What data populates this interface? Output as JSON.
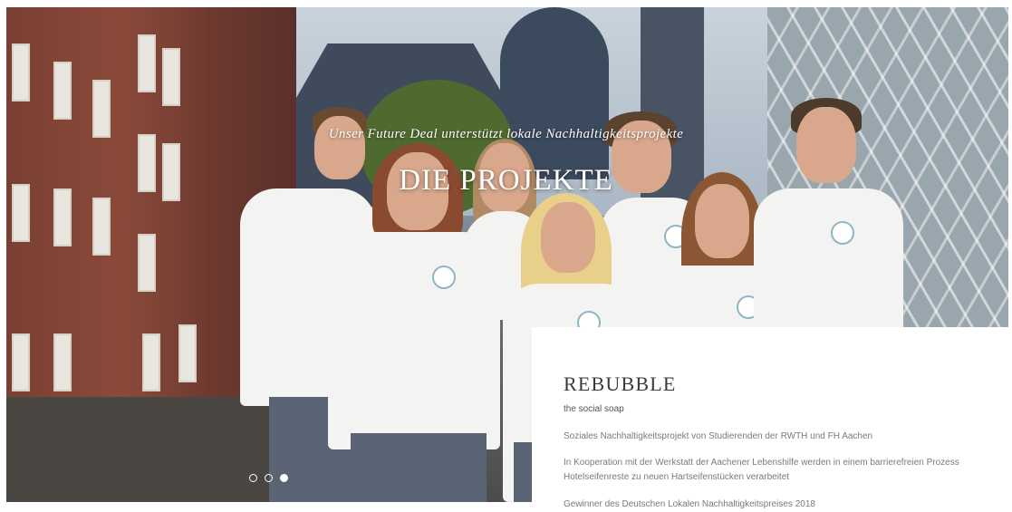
{
  "hero": {
    "subtitle": "Unser Future Deal unterstützt lokale Nachhaltigkeitsprojekte",
    "title": "DIE PROJEKTE",
    "slider": {
      "count": 3,
      "active_index": 3
    }
  },
  "project": {
    "name": "REBUBBLE",
    "tagline": "the social soap",
    "paragraphs": [
      "Soziales Nachhaltigkeitsprojekt von Studierenden der RWTH und FH Aachen",
      "In Kooperation mit der Werkstatt der Aachener Lebenshilfe werden in einem barrierefreien Prozess Hotelseifenreste zu neuen Hartseifenstücken verarbeitet",
      "Gewinner des Deutschen Lokalen Nachhaltigkeitspreises 2018"
    ]
  },
  "colors": {
    "overlay_text": "#ffffff",
    "card_bg": "#ffffff",
    "heading": "#3a3a3a",
    "body_text": "#7a7a7a"
  }
}
